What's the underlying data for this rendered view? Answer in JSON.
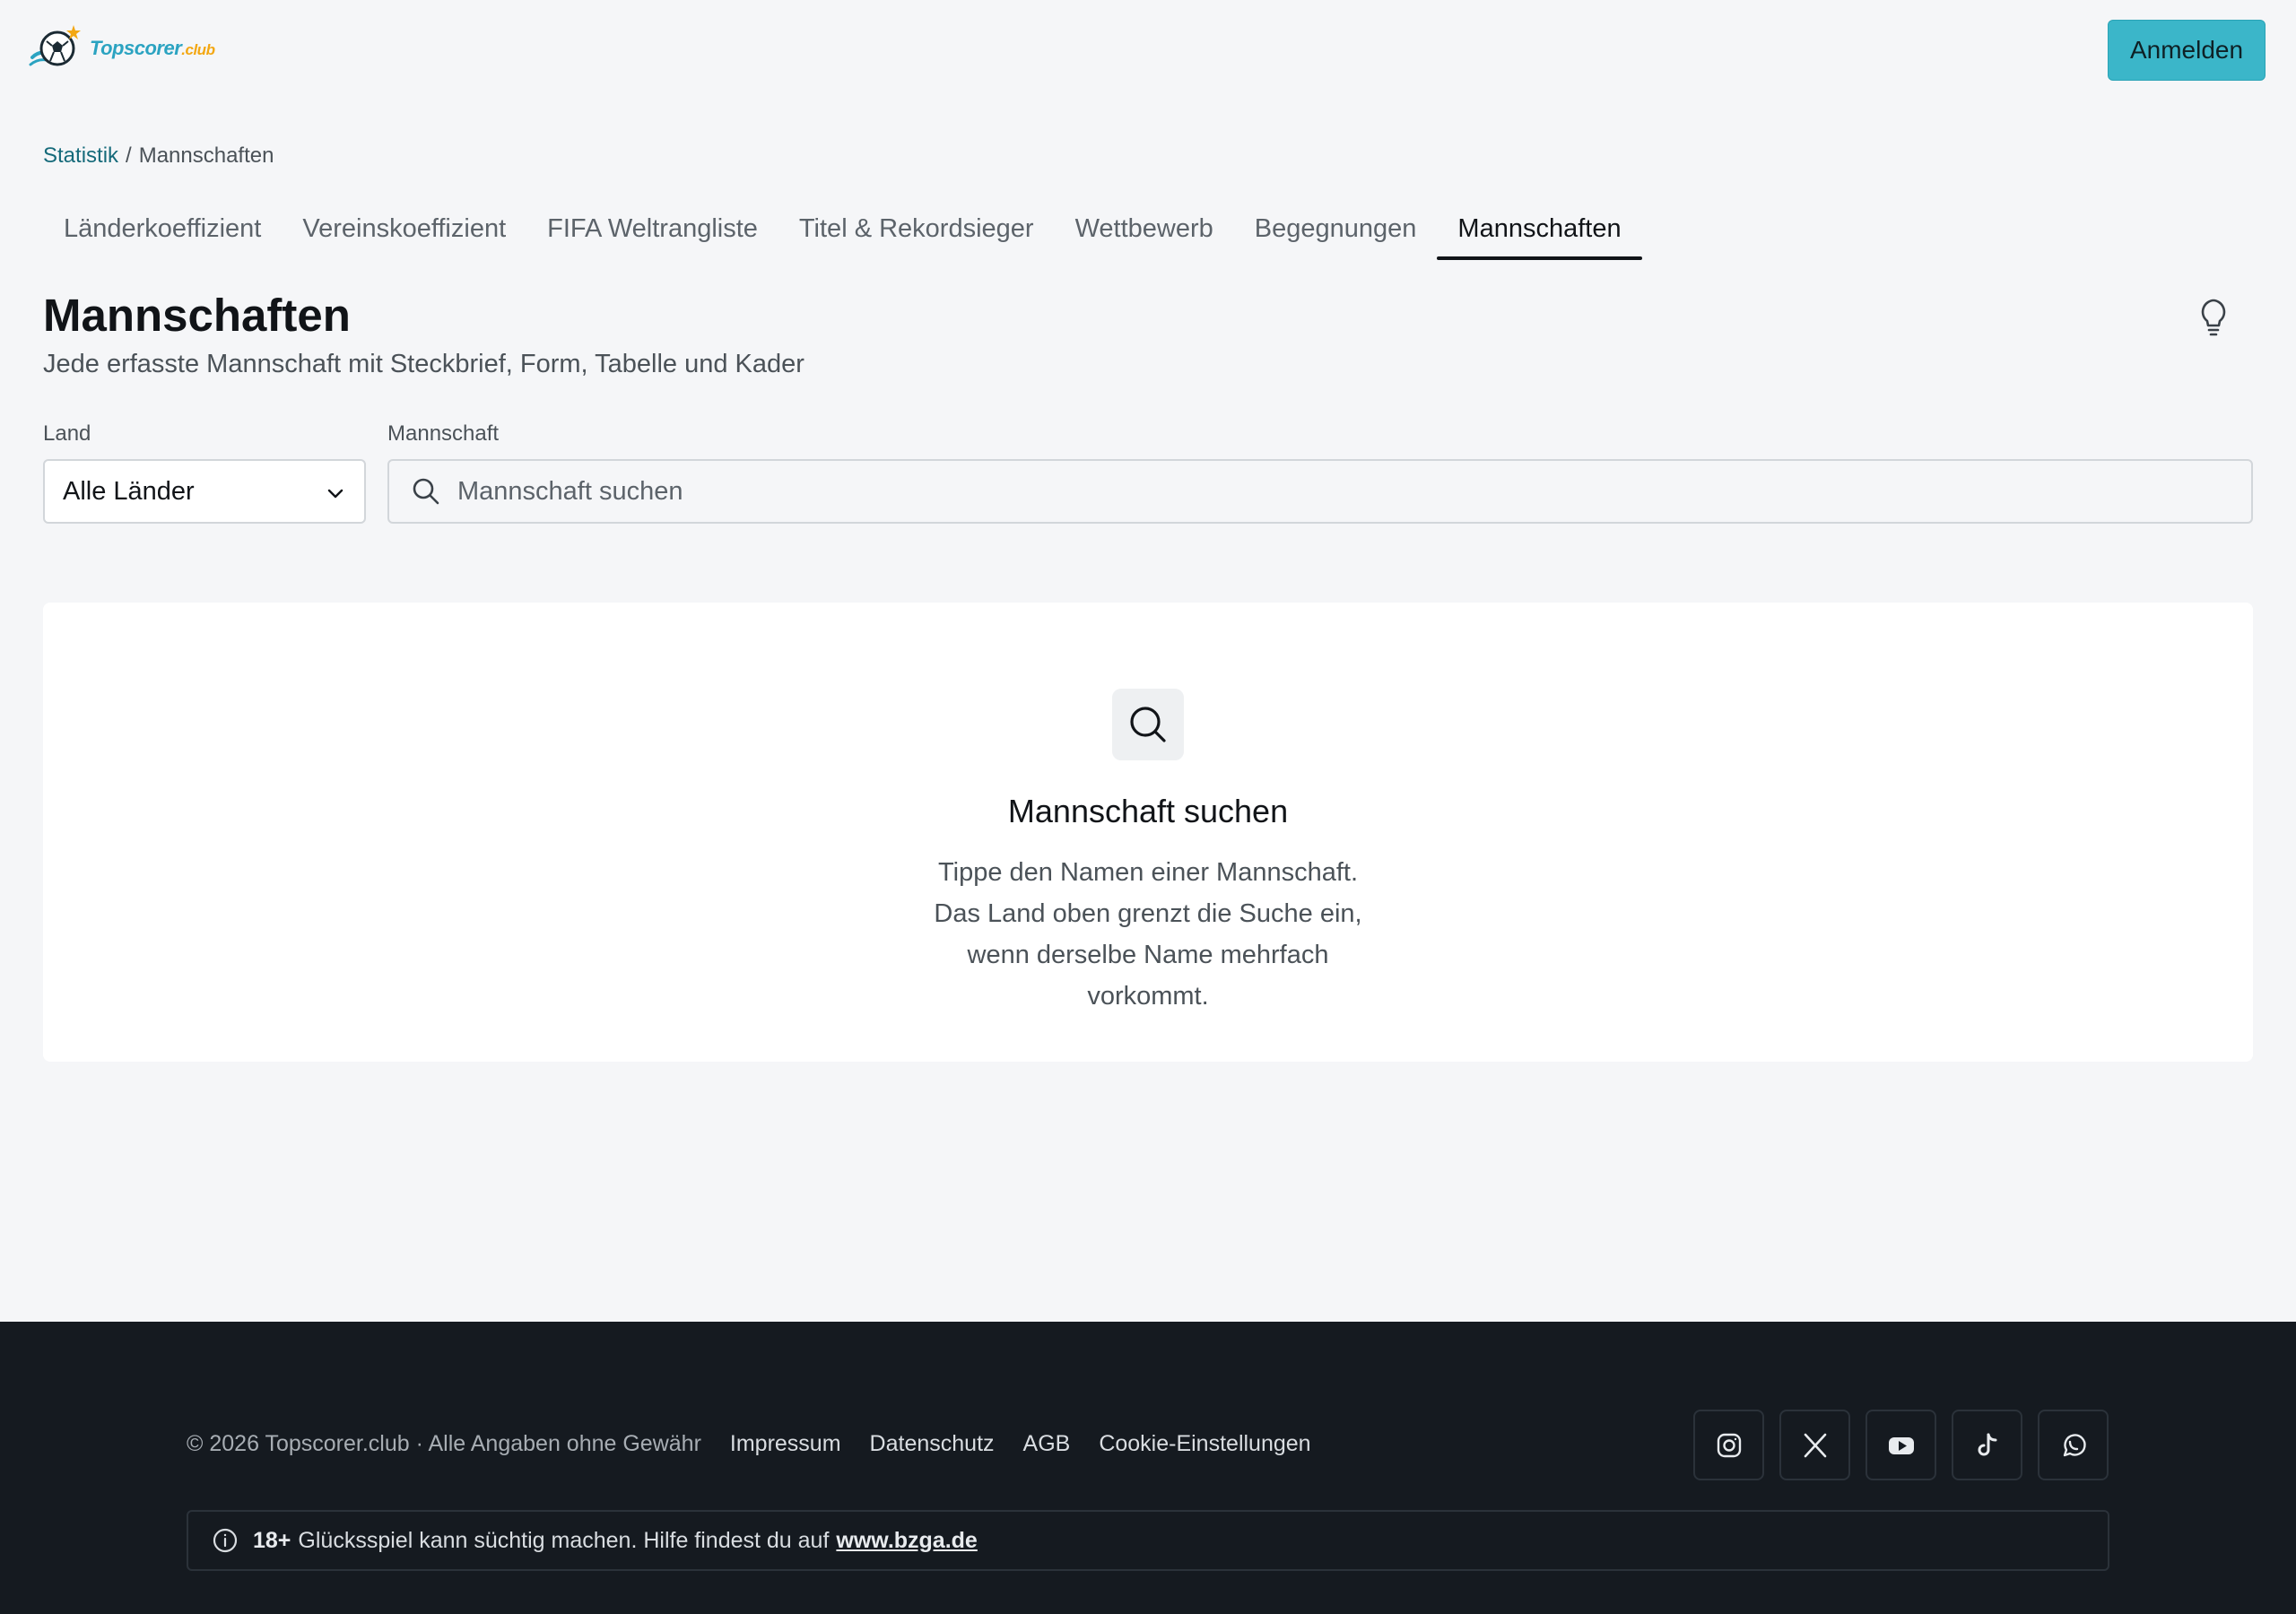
{
  "header": {
    "logo_name": "Topscorer",
    "logo_tld": ".club",
    "login_label": "Anmelden"
  },
  "breadcrumb": {
    "parent": "Statistik",
    "separator": "/",
    "current": "Mannschaften"
  },
  "tabs": [
    {
      "label": "Länderkoeffizient",
      "active": false
    },
    {
      "label": "Vereinskoeffizient",
      "active": false
    },
    {
      "label": "FIFA Weltrangliste",
      "active": false
    },
    {
      "label": "Titel & Rekordsieger",
      "active": false
    },
    {
      "label": "Wettbewerb",
      "active": false
    },
    {
      "label": "Begegnungen",
      "active": false
    },
    {
      "label": "Mannschaften",
      "active": true
    }
  ],
  "page": {
    "title": "Mannschaften",
    "subtitle": "Jede erfasste Mannschaft mit Steckbrief, Form, Tabelle und Kader",
    "tip_icon": "lightbulb-icon"
  },
  "filters": {
    "country_label": "Land",
    "country_value": "Alle Länder",
    "team_label": "Mannschaft",
    "team_placeholder": "Mannschaft suchen",
    "team_value": ""
  },
  "empty_state": {
    "icon": "search-icon",
    "title": "Mannschaft suchen",
    "text": "Tippe den Namen einer Mannschaft. Das Land oben grenzt die Suche ein, wenn derselbe Name mehrfach vorkommt."
  },
  "footer": {
    "copyright": "© 2026 Topscorer.club · Alle Angaben ohne Gewähr",
    "links": [
      "Impressum",
      "Datenschutz",
      "AGB",
      "Cookie-Einstellungen"
    ],
    "socials": [
      "instagram-icon",
      "x-icon",
      "youtube-icon",
      "tiktok-icon",
      "whatsapp-icon"
    ],
    "gambling": {
      "age": "18+",
      "text": "Glücksspiel kann süchtig machen. Hilfe findest du auf",
      "link": "www.bzga.de"
    }
  },
  "colors": {
    "accent": "#3bb6c9",
    "background": "#f5f6f8",
    "footer": "#151a20",
    "link": "#156a7a"
  }
}
